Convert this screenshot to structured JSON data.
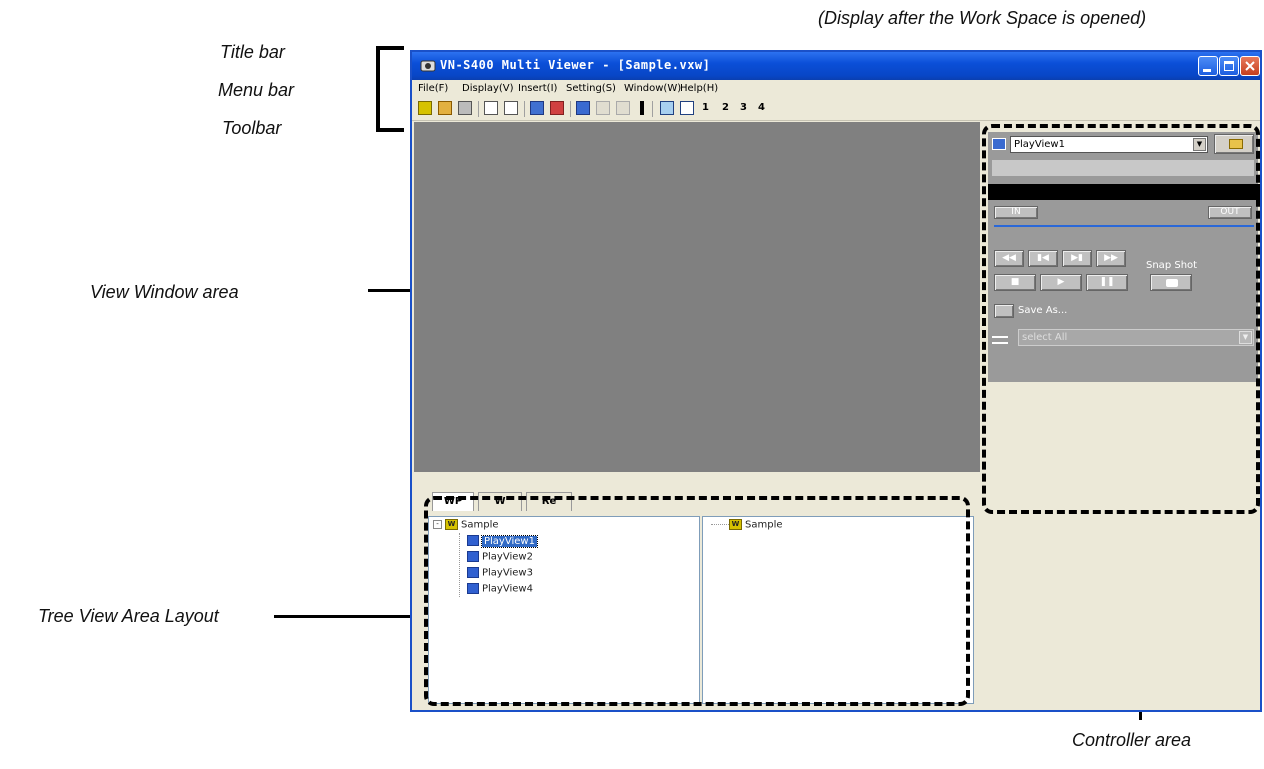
{
  "caption": "(Display after the Work Space is opened)",
  "annotations": {
    "title_bar": "Title bar",
    "menu_bar": "Menu bar",
    "toolbar": "Toolbar",
    "view_window": "View Window area",
    "tree_view": "Tree View Area Layout",
    "controller": "Controller area"
  },
  "window": {
    "title": "VN-S400 Multi Viewer - [Sample.vxw]",
    "menu": [
      "File(F)",
      "Display(V)",
      "Insert(I)",
      "Setting(S)",
      "Window(W)",
      "Help(H)"
    ],
    "toolbar_numbers": [
      "1",
      "2",
      "3",
      "4"
    ]
  },
  "tree": {
    "tabs": [
      "WP",
      "W",
      "Re"
    ],
    "root": "Sample",
    "items": [
      "PlayView1",
      "PlayView2",
      "PlayView3",
      "PlayView4"
    ],
    "selected": "PlayView1",
    "right_root": "Sample"
  },
  "controller": {
    "view_select": "PlayView1",
    "in_label": "IN",
    "out_label": "OUT",
    "snapshot_label": "Snap Shot",
    "save_as_label": "Save As...",
    "select_placeholder": "select All"
  },
  "colors": {
    "title_bar": "#0b4fd8",
    "view_area": "#808080",
    "controller_panel": "#9a9a9a",
    "window_bg": "#ece9d8"
  }
}
